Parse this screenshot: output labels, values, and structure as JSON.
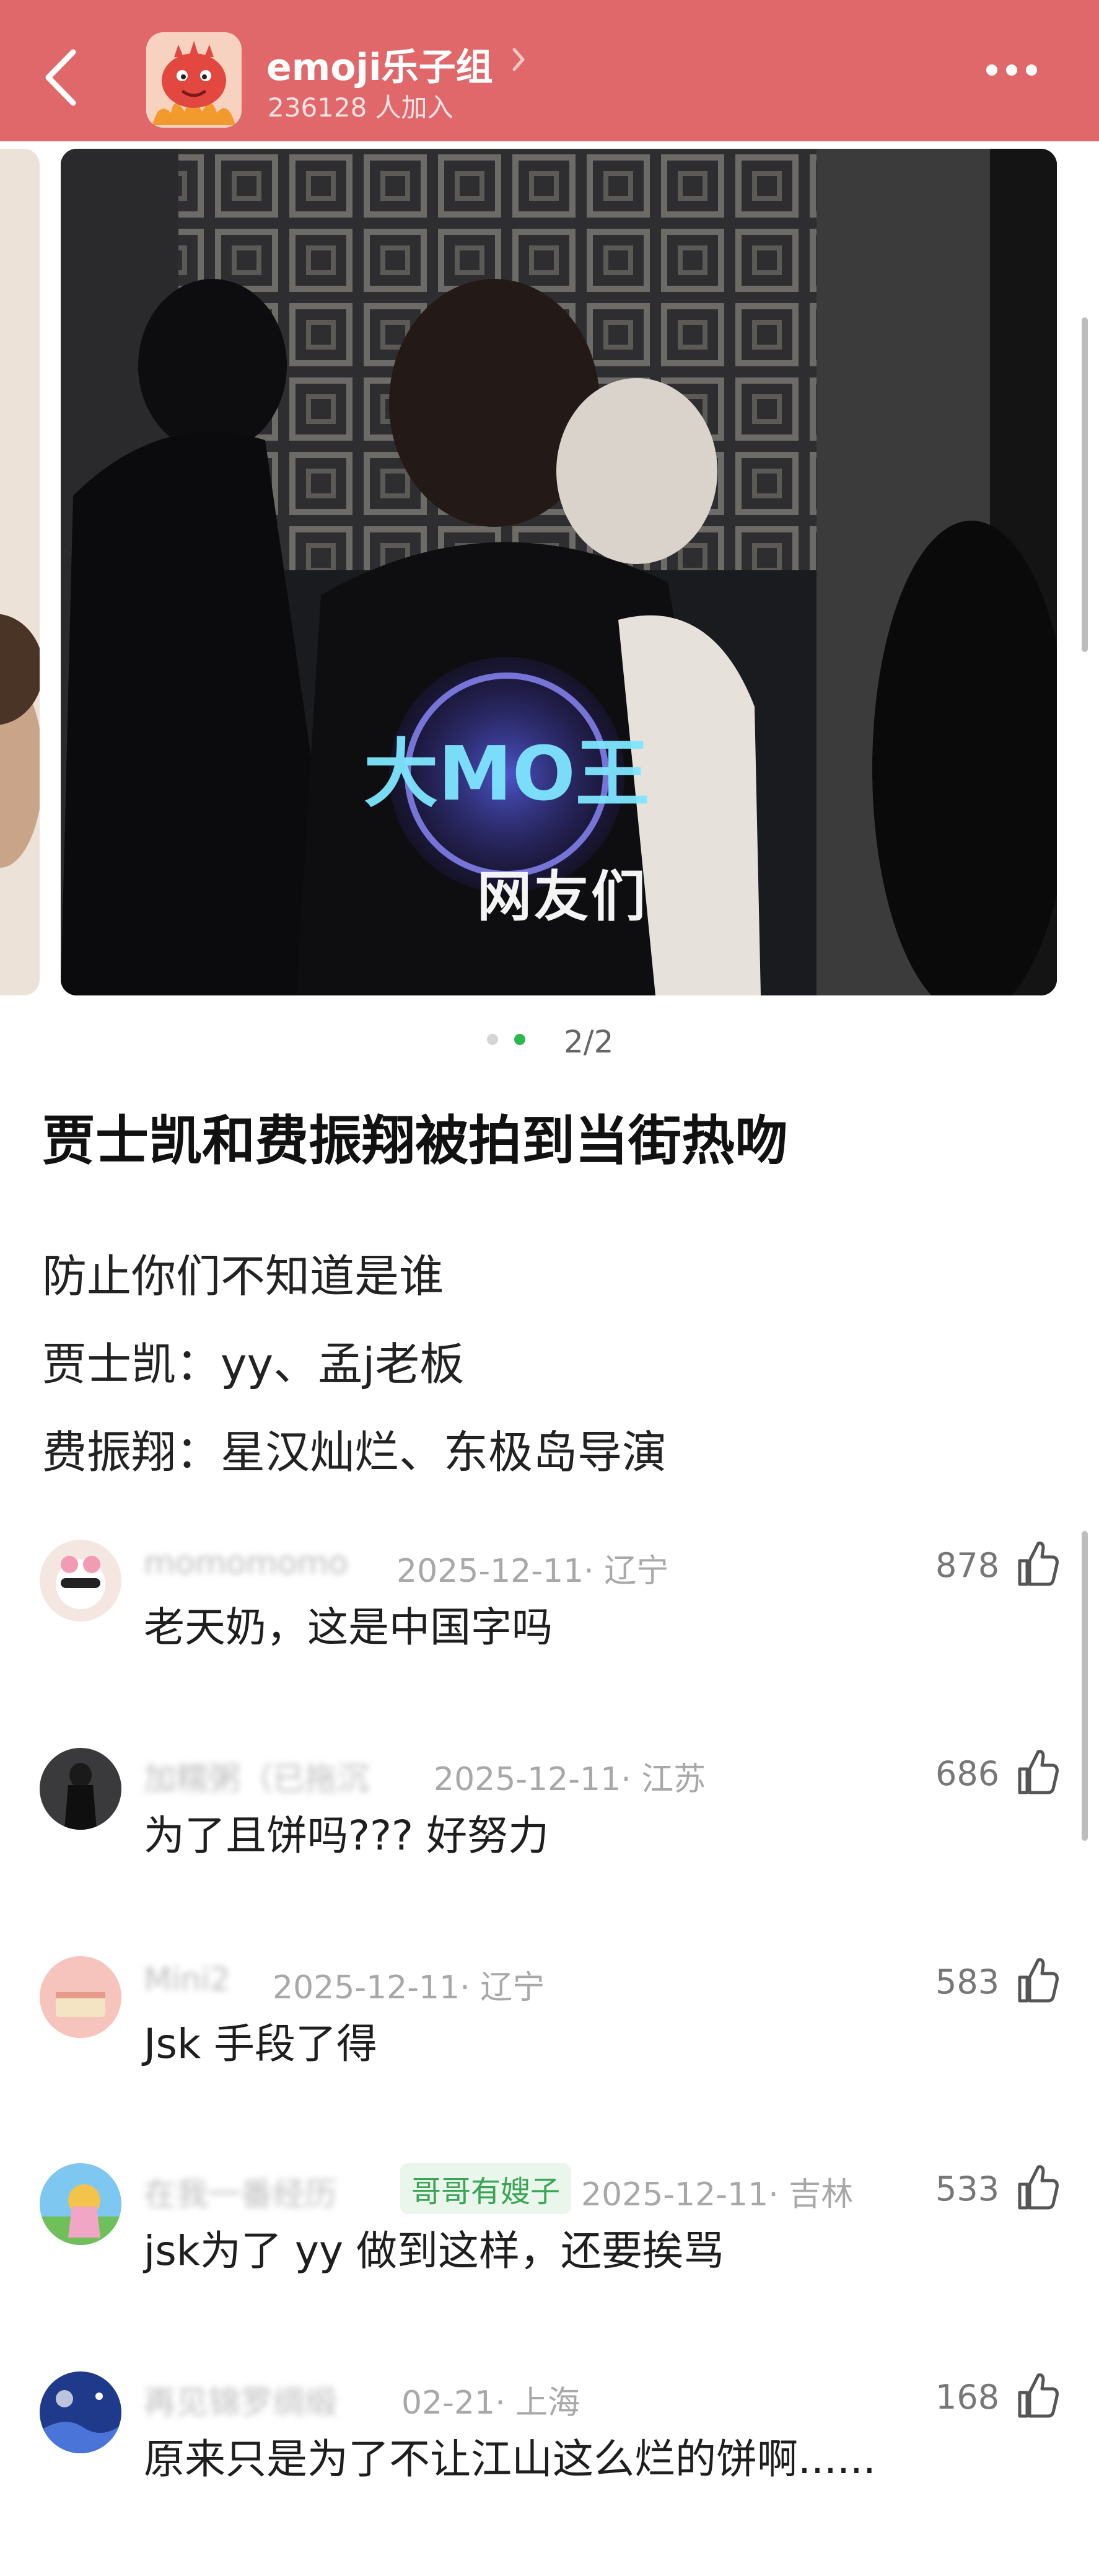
{
  "header": {
    "group_name": "emoji乐子组",
    "members": "236128 人加入",
    "background": "#e0686a"
  },
  "carousel": {
    "watermark": "网友们",
    "page_indicator": "2/2",
    "active_dot_color": "#2db84d"
  },
  "post": {
    "title": "贾士凯和费振翔被拍到当街热吻",
    "lines": [
      "防止你们不知道是谁",
      "贾士凯：yy、孟j老板",
      "费振翔：星汉灿烂、东极岛导演"
    ]
  },
  "comments": [
    {
      "name": "momomomo",
      "meta": "2025-12-11· 辽宁",
      "badge": "",
      "text": "老天奶，这是中国字吗",
      "likes": "878"
    },
    {
      "name": "加糯粥（已拖沉",
      "meta": "2025-12-11· 江苏",
      "badge": "",
      "text": "为了且饼吗???  好努力",
      "likes": "686"
    },
    {
      "name": "Mini2",
      "meta": "2025-12-11· 辽宁",
      "badge": "",
      "text": "Jsk 手段了得",
      "likes": "583"
    },
    {
      "name": "在我一番经历",
      "meta": "2025-12-11· 吉林",
      "badge": "哥哥有嫂子",
      "text": "jsk为了 yy 做到这样，还要挨骂",
      "likes": "533"
    },
    {
      "name": "再见锦罗绸缎",
      "meta": "02-21· 上海",
      "badge": "",
      "text": "原来只是为了不让江山这么烂的饼啊......",
      "likes": "168"
    }
  ]
}
